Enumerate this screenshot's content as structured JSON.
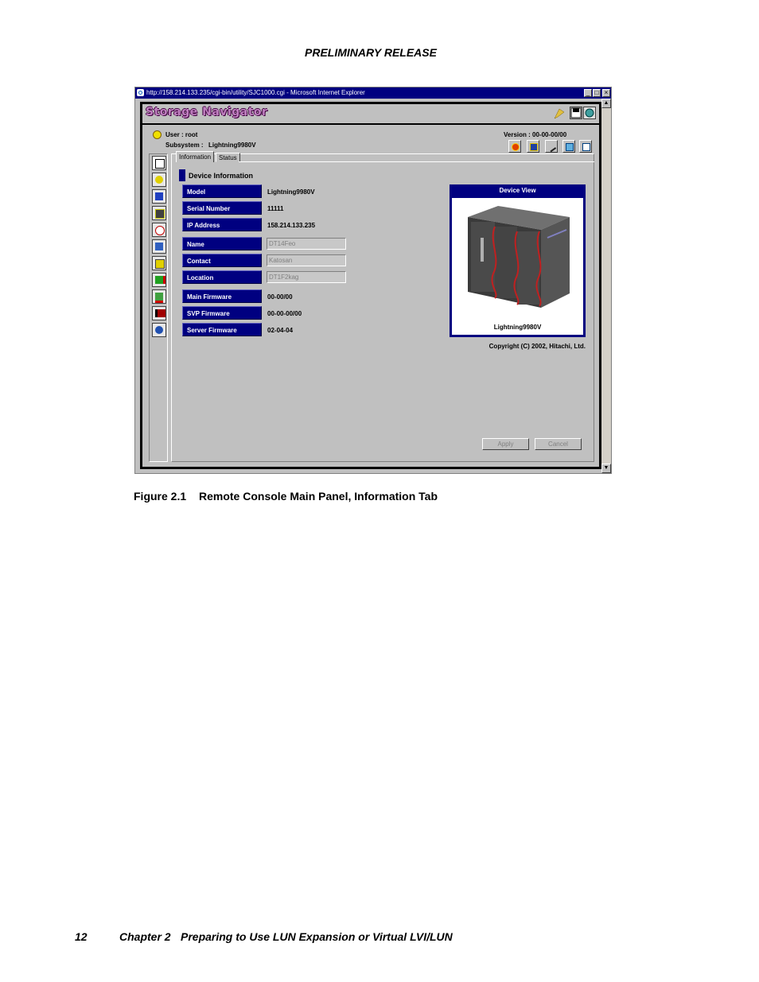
{
  "page": {
    "header": "PRELIMINARY RELEASE",
    "caption_number": "Figure 2.1",
    "caption_title": "Remote Console Main Panel, Information Tab",
    "footer_page": "12",
    "footer_chapter": "Chapter 2",
    "footer_title": "Preparing to Use LUN Expansion or Virtual LVI/LUN"
  },
  "window": {
    "title": "http://158.214.133.235/cgi-bin/utility/SJC1000.cgi - Microsoft Internet Explorer",
    "minimize": "_",
    "maximize": "□",
    "close": "×",
    "scroll_up": "▲",
    "scroll_down": "▼"
  },
  "app": {
    "logo": "Storage Navigator",
    "user_label": "User : root",
    "subsystem_label": "Subsystem :",
    "subsystem_value": "Lightning9980V",
    "version": "Version : 00-00-00/00",
    "status_color": "#f0e000",
    "accent_color": "#000080"
  },
  "tabs": [
    {
      "label": "Information",
      "selected": true
    },
    {
      "label": "Status",
      "selected": false
    }
  ],
  "section_title": "Device Information",
  "fields": {
    "model": {
      "label": "Model",
      "value": "Lightning9980V"
    },
    "serial": {
      "label": "Serial Number",
      "value": "11111"
    },
    "ip": {
      "label": "IP Address",
      "value": "158.214.133.235"
    },
    "name": {
      "label": "Name",
      "value": "DT14Feo"
    },
    "contact": {
      "label": "Contact",
      "value": "Katosan"
    },
    "location": {
      "label": "Location",
      "value": "DT1F2kag"
    },
    "main_fw": {
      "label": "Main Firmware",
      "value": "00-00/00"
    },
    "svp_fw": {
      "label": "SVP Firmware",
      "value": "00-00-00/00"
    },
    "server_fw": {
      "label": "Server Firmware",
      "value": "02-04-04"
    }
  },
  "device_view": {
    "title": "Device View",
    "name": "Lightning9980V",
    "copyright": "Copyright (C) 2002, Hitachi, Ltd."
  },
  "buttons": {
    "apply": "Apply",
    "cancel": "Cancel"
  }
}
